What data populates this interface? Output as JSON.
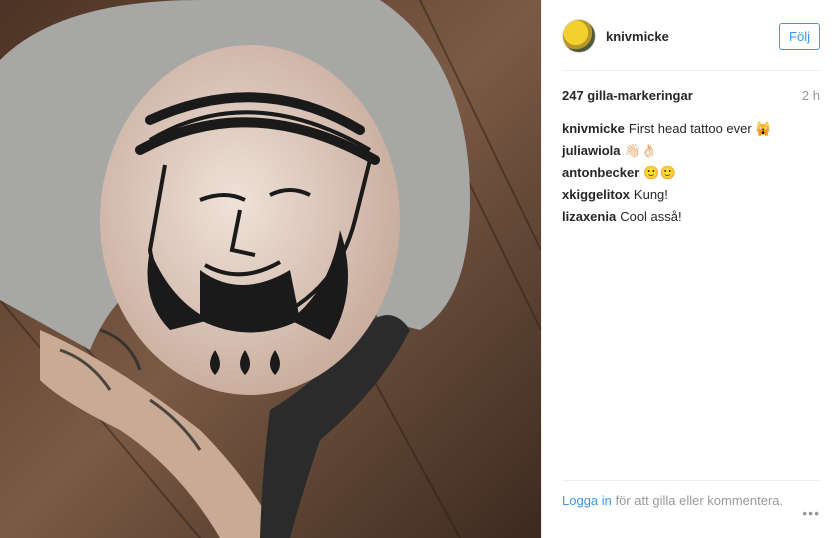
{
  "photo": {
    "alt": "",
    "icon": "tattoo-photo"
  },
  "post": {
    "username": "knivmicke",
    "follow_label": "Följ",
    "likes_text": "247 gilla-markeringar",
    "time_ago": "2 h",
    "comments": [
      {
        "user": "knivmicke",
        "text": "First head tattoo ever 🙀"
      },
      {
        "user": "juliawiola",
        "text": "👋🏻👌🏻"
      },
      {
        "user": "antonbecker",
        "text": "🙂🙂"
      },
      {
        "user": "xkiggelitox",
        "text": "Kung!"
      },
      {
        "user": "lizaxenia",
        "text": "Cool asså!"
      }
    ],
    "login_link": "Logga in",
    "login_rest": "för att gilla eller kommentera.",
    "more_label": "•••"
  },
  "colors": {
    "accent": "#3897f0",
    "muted": "#999999",
    "text": "#262626"
  }
}
